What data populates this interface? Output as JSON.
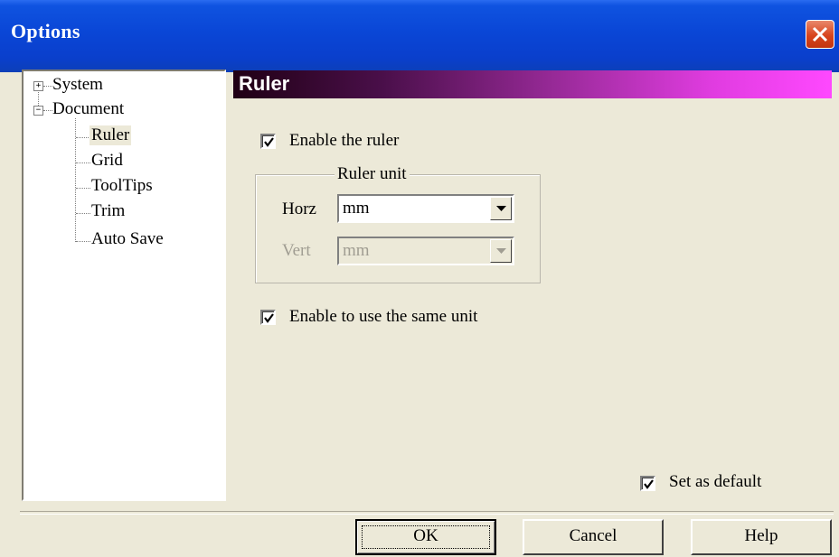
{
  "window": {
    "title": "Options"
  },
  "tree": {
    "items": [
      {
        "label": "System",
        "expander": "+"
      },
      {
        "label": "Document",
        "expander": "−"
      },
      {
        "label": "Ruler"
      },
      {
        "label": "Grid"
      },
      {
        "label": "ToolTips"
      },
      {
        "label": "Trim"
      },
      {
        "label": "Auto Save"
      }
    ],
    "selected": "Ruler"
  },
  "page": {
    "header": "Ruler",
    "enable_ruler": {
      "label": "Enable the ruler",
      "checked": true
    },
    "ruler_unit": {
      "caption": "Ruler unit",
      "horz_label": "Horz",
      "horz_value": "mm",
      "vert_label": "Vert",
      "vert_value": "mm",
      "vert_disabled": true
    },
    "same_unit": {
      "label": "Enable to use the same unit",
      "checked": true
    },
    "set_default": {
      "label": "Set as default",
      "checked": true
    }
  },
  "buttons": {
    "ok": "OK",
    "cancel": "Cancel",
    "help": "Help"
  },
  "colors": {
    "titlebar": "#0a46d6",
    "close": "#d8441c",
    "header_start": "#200014",
    "header_end": "#ff48ff"
  }
}
